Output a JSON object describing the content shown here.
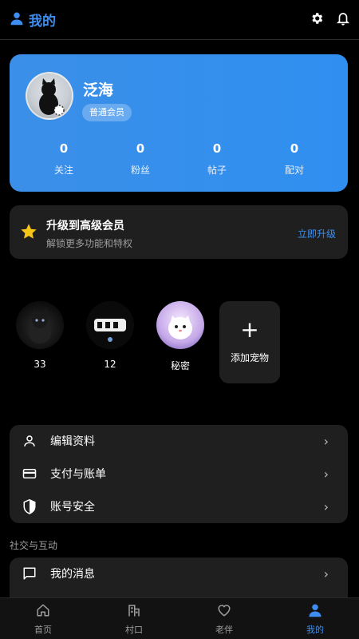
{
  "header": {
    "title": "我的",
    "icons": [
      "person-icon",
      "gear-icon",
      "bell-icon"
    ]
  },
  "profile": {
    "name": "泛海",
    "badge": "普通会员",
    "stats": [
      {
        "value": "0",
        "label": "关注"
      },
      {
        "value": "0",
        "label": "粉丝"
      },
      {
        "value": "0",
        "label": "帖子"
      },
      {
        "value": "0",
        "label": "配对"
      }
    ]
  },
  "upgrade": {
    "title": "升级到高级会员",
    "subtitle": "解锁更多功能和特权",
    "action": "立即升级"
  },
  "pets": {
    "items": [
      {
        "name": "33"
      },
      {
        "name": "12"
      },
      {
        "name": "秘密"
      }
    ],
    "add_label": "添加宠物",
    "add_symbol": "+"
  },
  "menu": [
    {
      "label": "编辑资料",
      "icon": "person-outline-icon"
    },
    {
      "label": "支付与账单",
      "icon": "credit-card-icon"
    },
    {
      "label": "账号安全",
      "icon": "shield-icon"
    }
  ],
  "social": {
    "section": "社交与互动",
    "items": [
      {
        "label": "我的消息",
        "icon": "chat-icon"
      }
    ]
  },
  "nav": [
    {
      "label": "首页",
      "icon": "home-icon",
      "active": false
    },
    {
      "label": "村口",
      "icon": "building-icon",
      "active": false
    },
    {
      "label": "老伴",
      "icon": "heart-icon",
      "active": false
    },
    {
      "label": "我的",
      "icon": "person-icon",
      "active": true
    }
  ],
  "colors": {
    "accent": "#3d8ef0",
    "card": "#1f1f1f",
    "profile_gradient": "#3b8fe8"
  }
}
